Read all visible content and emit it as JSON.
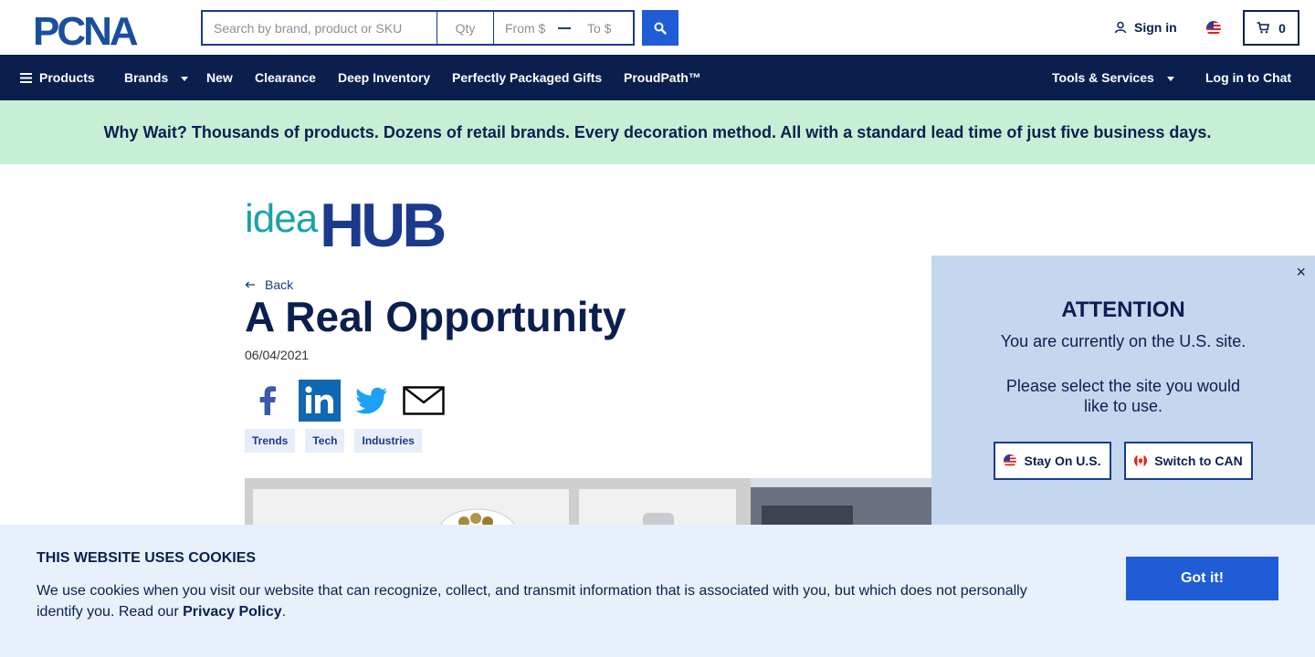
{
  "header": {
    "logo_text": "PCNA",
    "search_placeholder": "Search by brand, product or SKU",
    "qty_placeholder": "Qty",
    "from_placeholder": "From $",
    "to_placeholder": "To $",
    "sign_in_label": "Sign in",
    "cart_count": "0"
  },
  "nav": {
    "products": "Products",
    "brands": "Brands",
    "new": "New",
    "clearance": "Clearance",
    "deep_inventory": "Deep Inventory",
    "gifts": "Perfectly Packaged Gifts",
    "proudpath": "ProudPath™",
    "tools": "Tools & Services",
    "chat": "Log in to Chat"
  },
  "promo": {
    "text": "Why Wait? Thousands of products. Dozens of retail brands. Every decoration method. All with a standard lead time of just five business days."
  },
  "article": {
    "brand_light": "idea",
    "brand_bold": "HUB",
    "back_label": "Back",
    "title": "A Real Opportunity",
    "date": "06/04/2021",
    "tags": [
      "Trends",
      "Tech",
      "Industries"
    ]
  },
  "attention": {
    "close": "×",
    "title": "ATTENTION",
    "line1": "You are currently on the U.S. site.",
    "line2": "Please select the site you would like to use.",
    "stay_label": "Stay On U.S.",
    "switch_label": "Switch to CAN"
  },
  "cookies": {
    "title": "THIS WEBSITE USES COOKIES",
    "text": "We use cookies when you visit our website that can recognize, collect, and transmit information that is associated with you, but which does not personally identify you. Read our ",
    "link": "Privacy Policy",
    "end": ".",
    "button": "Got it!"
  },
  "colors": {
    "navy": "#0b1f4f",
    "accent_blue": "#1f5cd6",
    "promo_bg": "#c6efd6",
    "modal_bg": "#c5d7ee",
    "cookie_bg": "#e8f0fb"
  }
}
